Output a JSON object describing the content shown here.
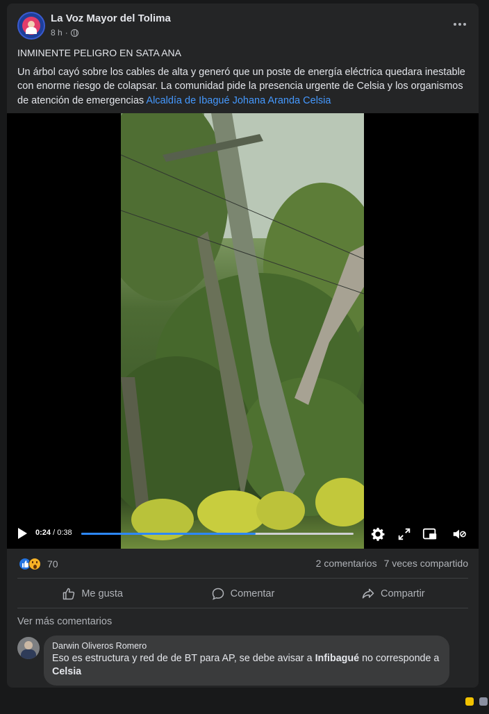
{
  "post": {
    "page_name": "La Voz Mayor del Tolima",
    "time": "8 h",
    "separator": "·",
    "title": "INMINENTE PELIGRO EN SATA ANA",
    "body": "Un árbol  cayó sobre los cables de alta y generó que un poste de energía eléctrica quedara inestable con enorme riesgo de colapsar. La comunidad pide la presencia urgente de Celsia y los organismos de atención de emergencias ",
    "tags": [
      "Alcaldía de Ibagué",
      "Johana Aranda",
      "Celsia"
    ]
  },
  "video": {
    "time_current": "0:24",
    "time_sep": " / ",
    "time_total": "0:38",
    "progress": 0.64
  },
  "stats": {
    "reaction_count": "70",
    "comments": "2 comentarios",
    "shares": "7 veces compartido"
  },
  "actions": {
    "like": "Me gusta",
    "comment": "Comentar",
    "share": "Compartir"
  },
  "comments": {
    "view_more": "Ver más comentarios",
    "items": [
      {
        "author": "Darwin Oliveros Romero",
        "text_1": "Eso es estructura y red de de BT para AP, se debe avisar a ",
        "mention_1": "Infibagué",
        "text_2": " no corresponde a ",
        "mention_2": "Celsia"
      }
    ]
  },
  "colors": {
    "background": "#18191a",
    "card": "#242526",
    "link": "#4599ff",
    "progress": "#2d88ff"
  }
}
